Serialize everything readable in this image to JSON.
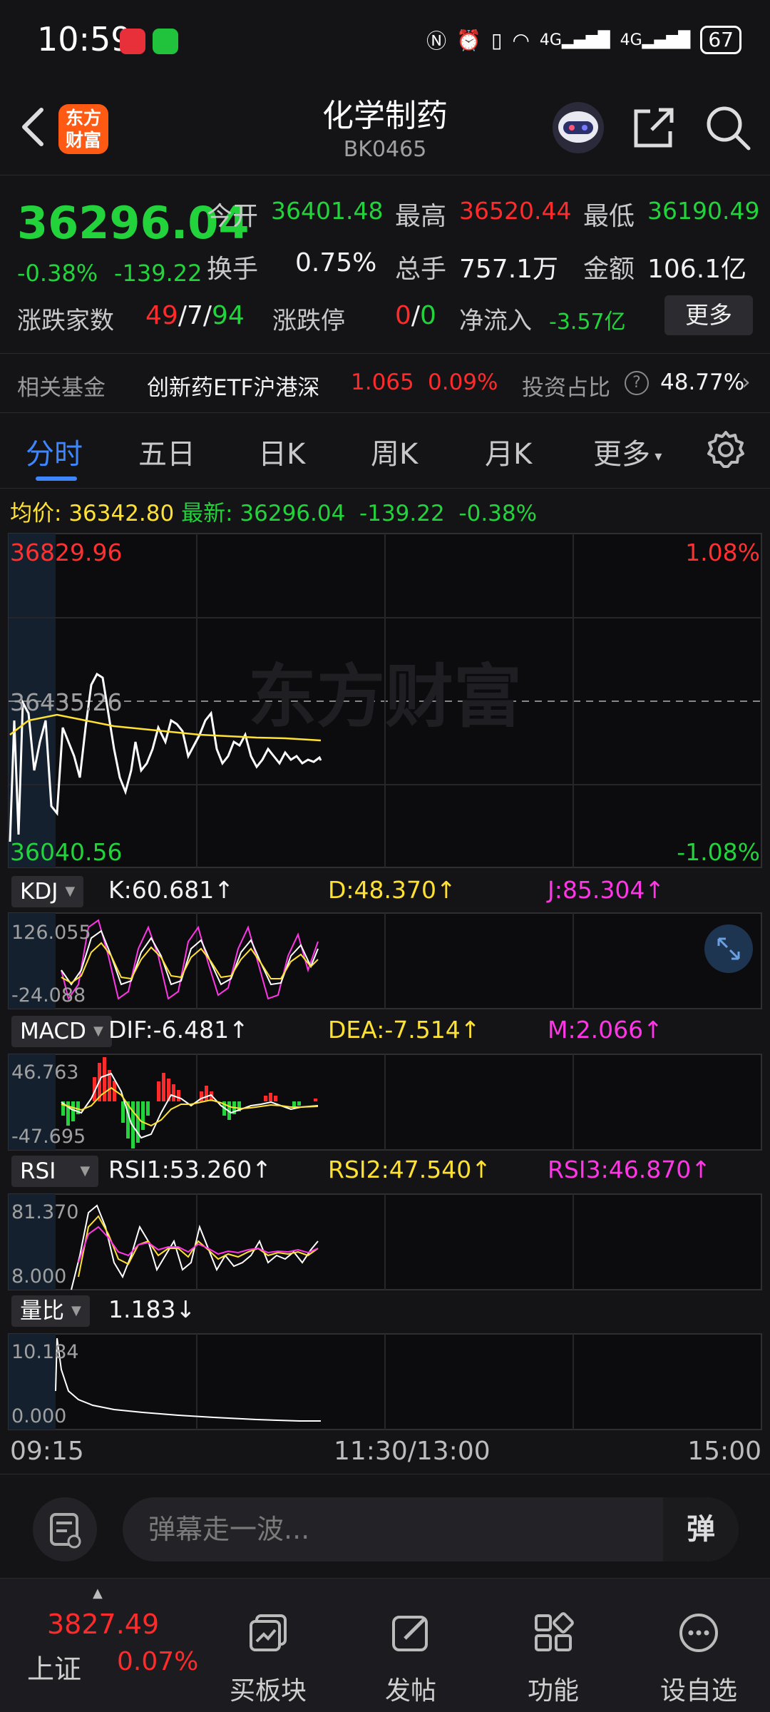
{
  "status_bar": {
    "time": "10:59",
    "network": "4G",
    "battery": "67"
  },
  "header": {
    "title": "化学制药",
    "code": "BK0465",
    "logo_text": "东方\n财富"
  },
  "quote": {
    "price": "36296.04",
    "change_pct": "-0.38%",
    "change": "-139.22",
    "open_label": "今开",
    "open": "36401.48",
    "high_label": "最高",
    "high": "36520.44",
    "low_label": "最低",
    "low": "36190.49",
    "turnover_label": "换手",
    "turnover": "0.75%",
    "volume_label": "总手",
    "volume": "757.1万",
    "amount_label": "金额",
    "amount": "106.1亿",
    "breadth_label": "涨跌家数",
    "breadth_up": "49",
    "breadth_flat": "7",
    "breadth_down": "94",
    "slash": "/",
    "limit_label": "涨跌停",
    "limit_up": "0",
    "limit_down": "0",
    "netflow_label": "净流入",
    "netflow": "-3.57亿",
    "more_label": "更多"
  },
  "fund": {
    "label": "相关基金",
    "name": "创新药ETF沪港深",
    "price": "1.065",
    "pct": "0.09%",
    "ratio_label": "投资占比",
    "ratio": "48.77%"
  },
  "tabs": [
    "分时",
    "五日",
    "日K",
    "周K",
    "月K",
    "更多"
  ],
  "info_line": {
    "avg_label": "均价:",
    "avg": "36342.80",
    "latest_label": "最新:",
    "latest": "36296.04",
    "change": "-139.22",
    "pct": "-0.38%"
  },
  "price_chart": {
    "top": "36829.96",
    "mid": "36435.26",
    "bottom": "36040.56",
    "top_pct": "1.08%",
    "bottom_pct": "-1.08%",
    "watermark": "东方财富"
  },
  "kdj": {
    "label": "KDJ",
    "k": "K:60.681↑",
    "d": "D:48.370↑",
    "j": "J:85.304↑",
    "max": "126.055",
    "min": "-24.088"
  },
  "macd": {
    "label": "MACD",
    "dif": "DIF:-6.481↑",
    "dea": "DEA:-7.514↑",
    "m": "M:2.066↑",
    "max": "46.763",
    "min": "-47.695"
  },
  "rsi": {
    "label": "RSI",
    "rsi1": "RSI1:53.260↑",
    "rsi2": "RSI2:47.540↑",
    "rsi3": "RSI3:46.870↑",
    "max": "81.370",
    "min": "8.000"
  },
  "vol_ratio": {
    "label": "量比",
    "value": "1.183↓",
    "max": "10.184",
    "min": "0.000"
  },
  "time_axis": {
    "start": "09:15",
    "mid": "11:30/13:00",
    "end": "15:00"
  },
  "comment": {
    "placeholder": "弹幕走一波...",
    "danmu": "弹"
  },
  "bottom_nav": {
    "index_value": "3827.49",
    "index_name": "上证",
    "index_pct": "0.07%",
    "items": [
      "买板块",
      "发帖",
      "功能",
      "设自选"
    ]
  },
  "colors": {
    "up": "#ff2a2a",
    "down": "#22d33c",
    "accent": "#3d86ff",
    "avg_line": "#ffe133",
    "magenta": "#ff36e6"
  }
}
